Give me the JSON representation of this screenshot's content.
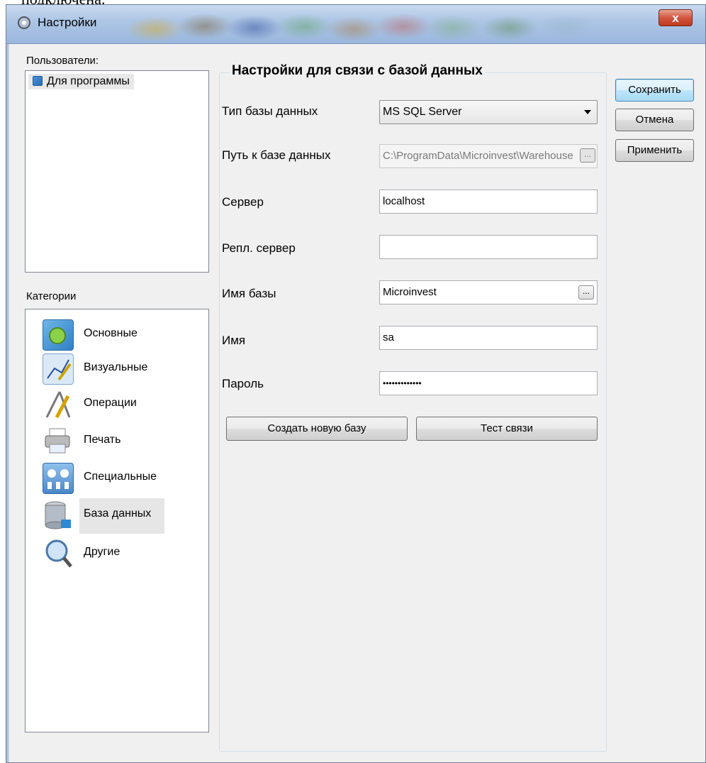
{
  "caption_fragment": "подключена.",
  "window": {
    "title": "Настройки",
    "close_label": "x"
  },
  "users": {
    "label": "Пользователи:",
    "items": [
      "Для программы"
    ]
  },
  "categories": {
    "label": "Категории",
    "items": [
      {
        "label": "Основные",
        "icon": "settings-icon"
      },
      {
        "label": "Визуальные",
        "icon": "chart-icon"
      },
      {
        "label": "Операции",
        "icon": "tools-icon"
      },
      {
        "label": "Печать",
        "icon": "printer-icon"
      },
      {
        "label": "Специальные",
        "icon": "special-icon"
      },
      {
        "label": "База данных",
        "icon": "database-icon",
        "selected": true
      },
      {
        "label": "Другие",
        "icon": "search-icon"
      }
    ]
  },
  "db_settings": {
    "title": "Настройки для связи с базой данных",
    "db_type_label": "Тип базы данных",
    "db_type_value": "MS SQL Server",
    "db_path_label": "Путь к базе данных",
    "db_path_value": "C:\\ProgramData\\Microinvest\\Warehouse",
    "server_label": "Сервер",
    "server_value": "localhost",
    "repl_server_label": "Репл. сервер",
    "repl_server_value": "",
    "db_name_label": "Имя базы",
    "db_name_value": "Microinvest",
    "user_label": "Имя",
    "user_value": "sa",
    "password_label": "Пароль",
    "password_value": "•••••••••••••",
    "ellipsis_label": "...",
    "create_db_button": "Создать новую базу",
    "test_connection_button": "Тест связи"
  },
  "actions": {
    "save": "Сохранить",
    "cancel": "Отмена",
    "apply": "Применить"
  }
}
